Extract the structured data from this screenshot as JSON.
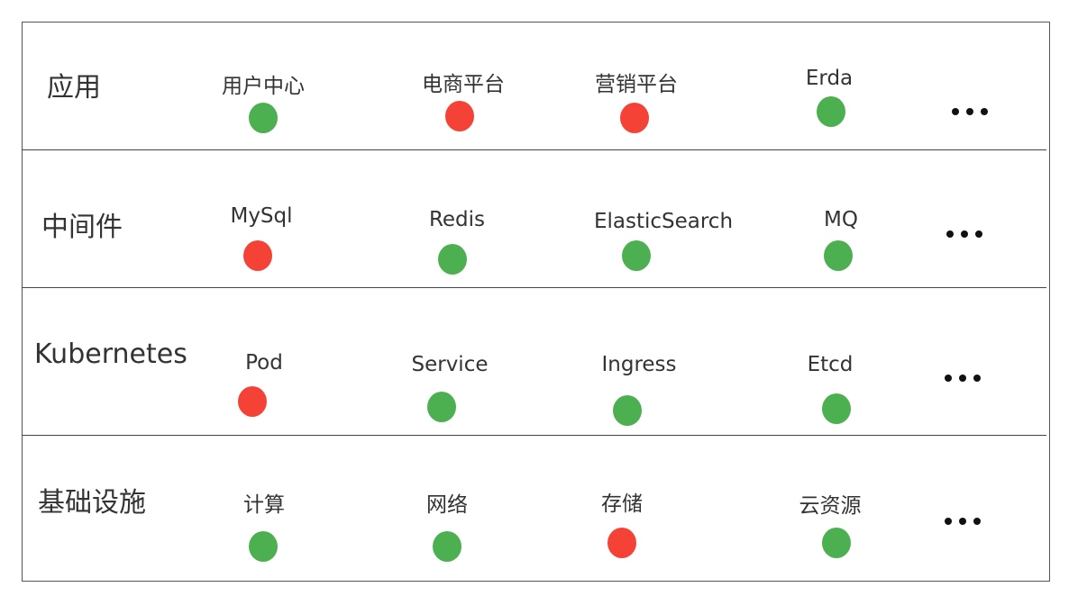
{
  "colors": {
    "healthy": "#4caf50",
    "unhealthy": "#f44336",
    "text": "#333333",
    "border": "#555555"
  },
  "more_icon": "ellipsis-icon",
  "layers": [
    {
      "title": "应用",
      "items": [
        {
          "label": "用户中心",
          "status": "healthy"
        },
        {
          "label": "电商平台",
          "status": "unhealthy"
        },
        {
          "label": "营销平台",
          "status": "unhealthy"
        },
        {
          "label": "Erda",
          "status": "healthy"
        }
      ]
    },
    {
      "title": "中间件",
      "items": [
        {
          "label": "MySql",
          "status": "unhealthy"
        },
        {
          "label": "Redis",
          "status": "healthy"
        },
        {
          "label": "ElasticSearch",
          "status": "healthy"
        },
        {
          "label": "MQ",
          "status": "healthy"
        }
      ]
    },
    {
      "title": "Kubernetes",
      "items": [
        {
          "label": "Pod",
          "status": "unhealthy"
        },
        {
          "label": "Service",
          "status": "healthy"
        },
        {
          "label": "Ingress",
          "status": "healthy"
        },
        {
          "label": "Etcd",
          "status": "healthy"
        }
      ]
    },
    {
      "title": "基础设施",
      "items": [
        {
          "label": "计算",
          "status": "healthy"
        },
        {
          "label": "网络",
          "status": "healthy"
        },
        {
          "label": "存储",
          "status": "unhealthy"
        },
        {
          "label": "云资源",
          "status": "healthy"
        }
      ]
    }
  ]
}
